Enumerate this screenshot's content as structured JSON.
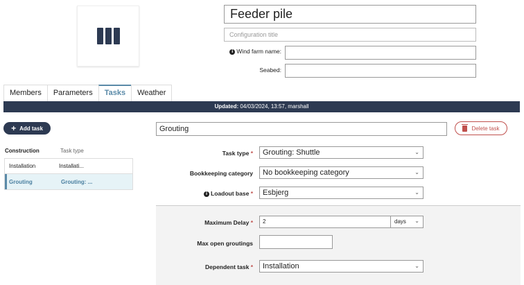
{
  "header": {
    "title": "Feeder pile",
    "config_title_placeholder": "Configuration title",
    "wind_farm_label": "Wind farm name:",
    "wind_farm_value": "",
    "seabed_label": "Seabed:",
    "seabed_value": ""
  },
  "tabs": [
    {
      "label": "Members",
      "active": false
    },
    {
      "label": "Parameters",
      "active": false
    },
    {
      "label": "Tasks",
      "active": true
    },
    {
      "label": "Weather",
      "active": false
    }
  ],
  "updated": {
    "label": "Updated:",
    "value": "04/03/2024, 13:57, marshall"
  },
  "sidebar": {
    "add_task_label": "Add task",
    "col_construction": "Construction",
    "col_task_type": "Task type",
    "tasks": [
      {
        "name": "Installation",
        "type": "Installati..."
      },
      {
        "name": "Grouting",
        "type": "Grouting: ..."
      }
    ]
  },
  "task": {
    "name": "Grouting",
    "delete_label": "Delete task",
    "task_type_label": "Task type",
    "task_type_value": "Grouting: Shuttle",
    "bookkeeping_label": "Bookkeeping category",
    "bookkeeping_value": "No bookkeeping category",
    "loadout_label": "Loadout base",
    "loadout_value": "Esbjerg",
    "max_delay_label": "Maximum Delay",
    "max_delay_value": "2",
    "max_delay_unit": "days",
    "max_open_label": "Max open groutings",
    "max_open_value": "",
    "dependent_label": "Dependent task",
    "dependent_value": "Installation"
  },
  "colors": {
    "navy": "#2d3a52",
    "accent": "#5a8aa8",
    "danger": "#c0504d"
  }
}
